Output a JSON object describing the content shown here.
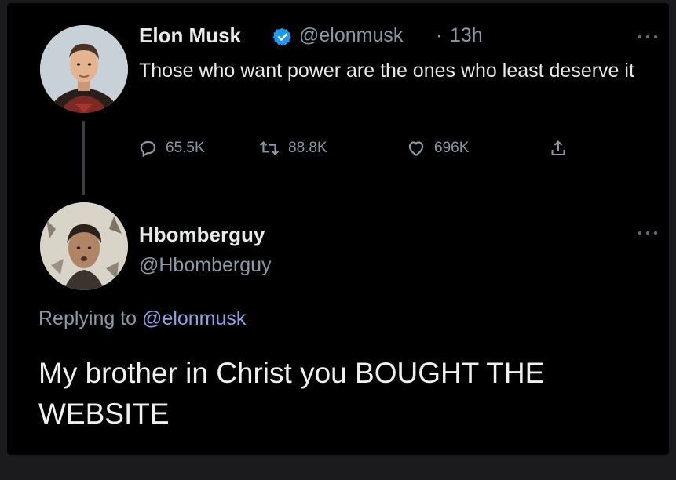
{
  "tweet": {
    "author_name": "Elon Musk",
    "handle": "@elonmusk",
    "separator": "·",
    "time": "13h",
    "text": "Those who want power are the ones who least deserve it",
    "verified_icon": "verified-badge-icon",
    "actions": {
      "replies": "65.5K",
      "retweets": "88.8K",
      "likes": "696K"
    }
  },
  "reply": {
    "author_name": "Hbomberguy",
    "handle": "@Hbomberguy",
    "replying_prefix": "Replying to",
    "replying_to": "@elonmusk",
    "text": "My brother in Christ you BOUGHT THE WEBSITE"
  },
  "colors": {
    "background": "#000000",
    "text_primary": "#e7e9ea",
    "text_secondary": "#8b98a5",
    "verified": "#1d9bf0",
    "mention": "#8fa0e0"
  }
}
